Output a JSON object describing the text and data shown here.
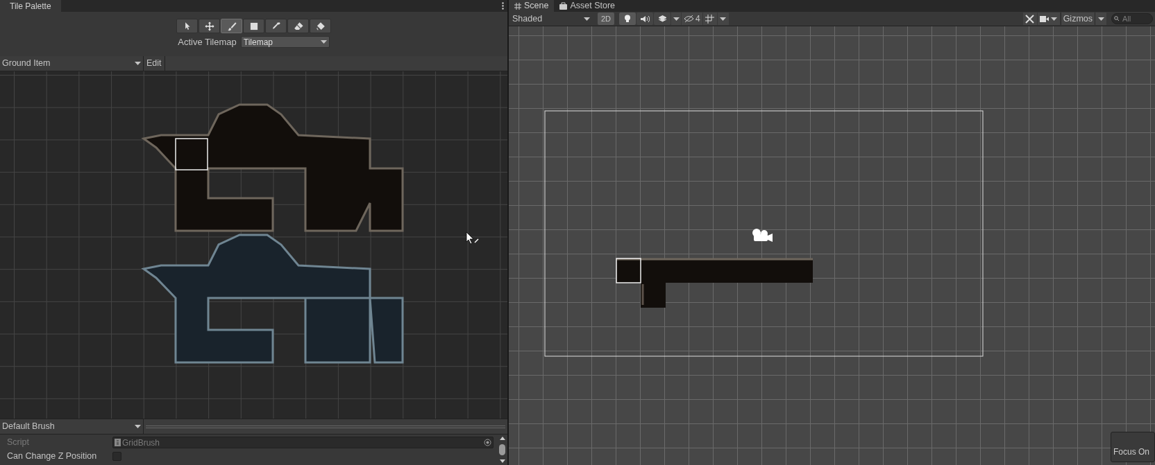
{
  "left_panel": {
    "tab": {
      "label": "Tile Palette",
      "selected": true
    },
    "tools": [
      {
        "kind": "select",
        "selected": false
      },
      {
        "kind": "move",
        "selected": false
      },
      {
        "kind": "paint",
        "selected": true
      },
      {
        "kind": "box",
        "selected": false
      },
      {
        "kind": "picker",
        "selected": false
      },
      {
        "kind": "erase",
        "selected": false
      },
      {
        "kind": "fill",
        "selected": false
      }
    ],
    "active_tilemap": {
      "label": "Active Tilemap",
      "value": "Tilemap"
    },
    "palette": {
      "value": "Ground Item",
      "edit_button": "Edit"
    },
    "brush": {
      "value": "Default Brush"
    },
    "inspector": [
      {
        "kind": "object",
        "label": "Script",
        "value": "GridBrush",
        "disabled": true
      },
      {
        "kind": "checkbox",
        "label": "Can Change Z Position",
        "checked": false,
        "disabled": false
      }
    ]
  },
  "right_panel": {
    "tabs": [
      {
        "label": "Scene",
        "kind": "scene",
        "selected": true
      },
      {
        "label": "Asset Store",
        "kind": "store",
        "selected": false
      }
    ],
    "toolbar": {
      "draw_mode": "Shaded",
      "toggles": [
        {
          "kind": "text",
          "label": "2D",
          "on": true
        },
        {
          "kind": "light",
          "on": true
        },
        {
          "kind": "audio",
          "on": false
        },
        {
          "kind": "effects",
          "on": false
        }
      ],
      "hidden_count": "4",
      "gizmos": "Gizmos",
      "search_placeholder": "All"
    },
    "overlay": {
      "label": "Focus On"
    }
  }
}
